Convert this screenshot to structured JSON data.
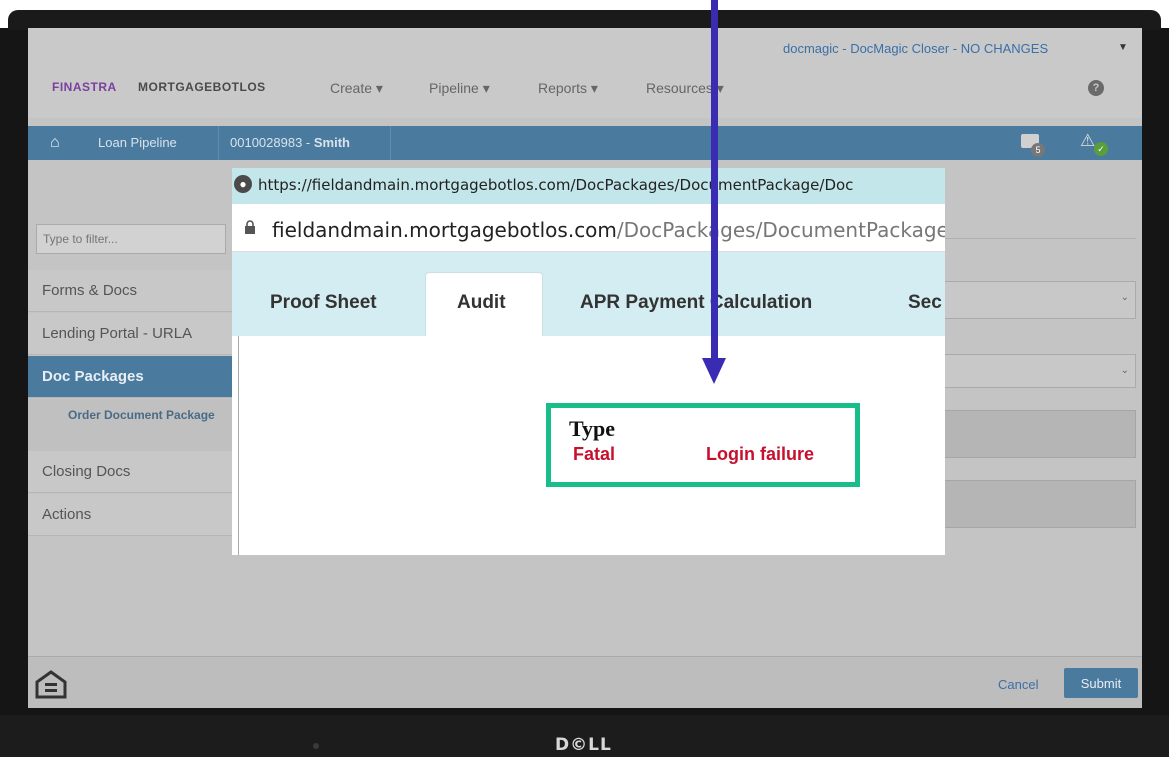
{
  "app": {
    "brand_primary": "FINASTRA",
    "brand_secondary": "MORTGAGEBOTLOS",
    "user_menu": "docmagic - DocMagic Closer - NO CHANGES",
    "help_symbol": "?"
  },
  "nav": {
    "items": [
      {
        "label": "Create ▾"
      },
      {
        "label": "Pipeline ▾"
      },
      {
        "label": "Reports ▾"
      },
      {
        "label": "Resources ▾"
      }
    ]
  },
  "breadcrumb": {
    "loan_pipeline": "Loan Pipeline",
    "loan_number": "0010028983 - ",
    "borrower": "Smith",
    "folder_count": "5"
  },
  "sidebar": {
    "filter_placeholder": "Type to filter...",
    "items": [
      {
        "label": "Forms & Docs"
      },
      {
        "label": "Lending Portal - URLA"
      },
      {
        "label": "Doc Packages"
      },
      {
        "label": "Order Document Package"
      },
      {
        "label": "Closing Docs"
      },
      {
        "label": "Actions"
      }
    ]
  },
  "footer": {
    "cancel_label": "Cancel",
    "submit_label": "Submit"
  },
  "popup": {
    "url_short": "https://fieldandmain.mortgagebotlos.com/DocPackages/DocumentPackage/Doc",
    "url_domain": "fieldandmain.mortgagebotlos.com",
    "url_path": "/DocPackages/DocumentPackage",
    "tabs": [
      {
        "label": "Proof Sheet"
      },
      {
        "label": "Audit"
      },
      {
        "label": "APR Payment Calculation"
      },
      {
        "label": "Sec"
      }
    ],
    "type_header": "Type",
    "error_level": "Fatal",
    "error_message": "Login failure"
  },
  "device": {
    "logo": "D©LL"
  },
  "colors": {
    "accent_blue": "#4a7a9e",
    "highlight_green": "#19bd8a",
    "error_red": "#c8102e",
    "arrow_purple": "#3a2bb3"
  },
  "icons": {
    "home": "home-icon",
    "folder": "folder-icon",
    "warning": "warning-icon",
    "help": "help-icon",
    "lock": "lock-icon",
    "globe": "globe-icon",
    "equal_housing": "equal-housing-icon"
  }
}
